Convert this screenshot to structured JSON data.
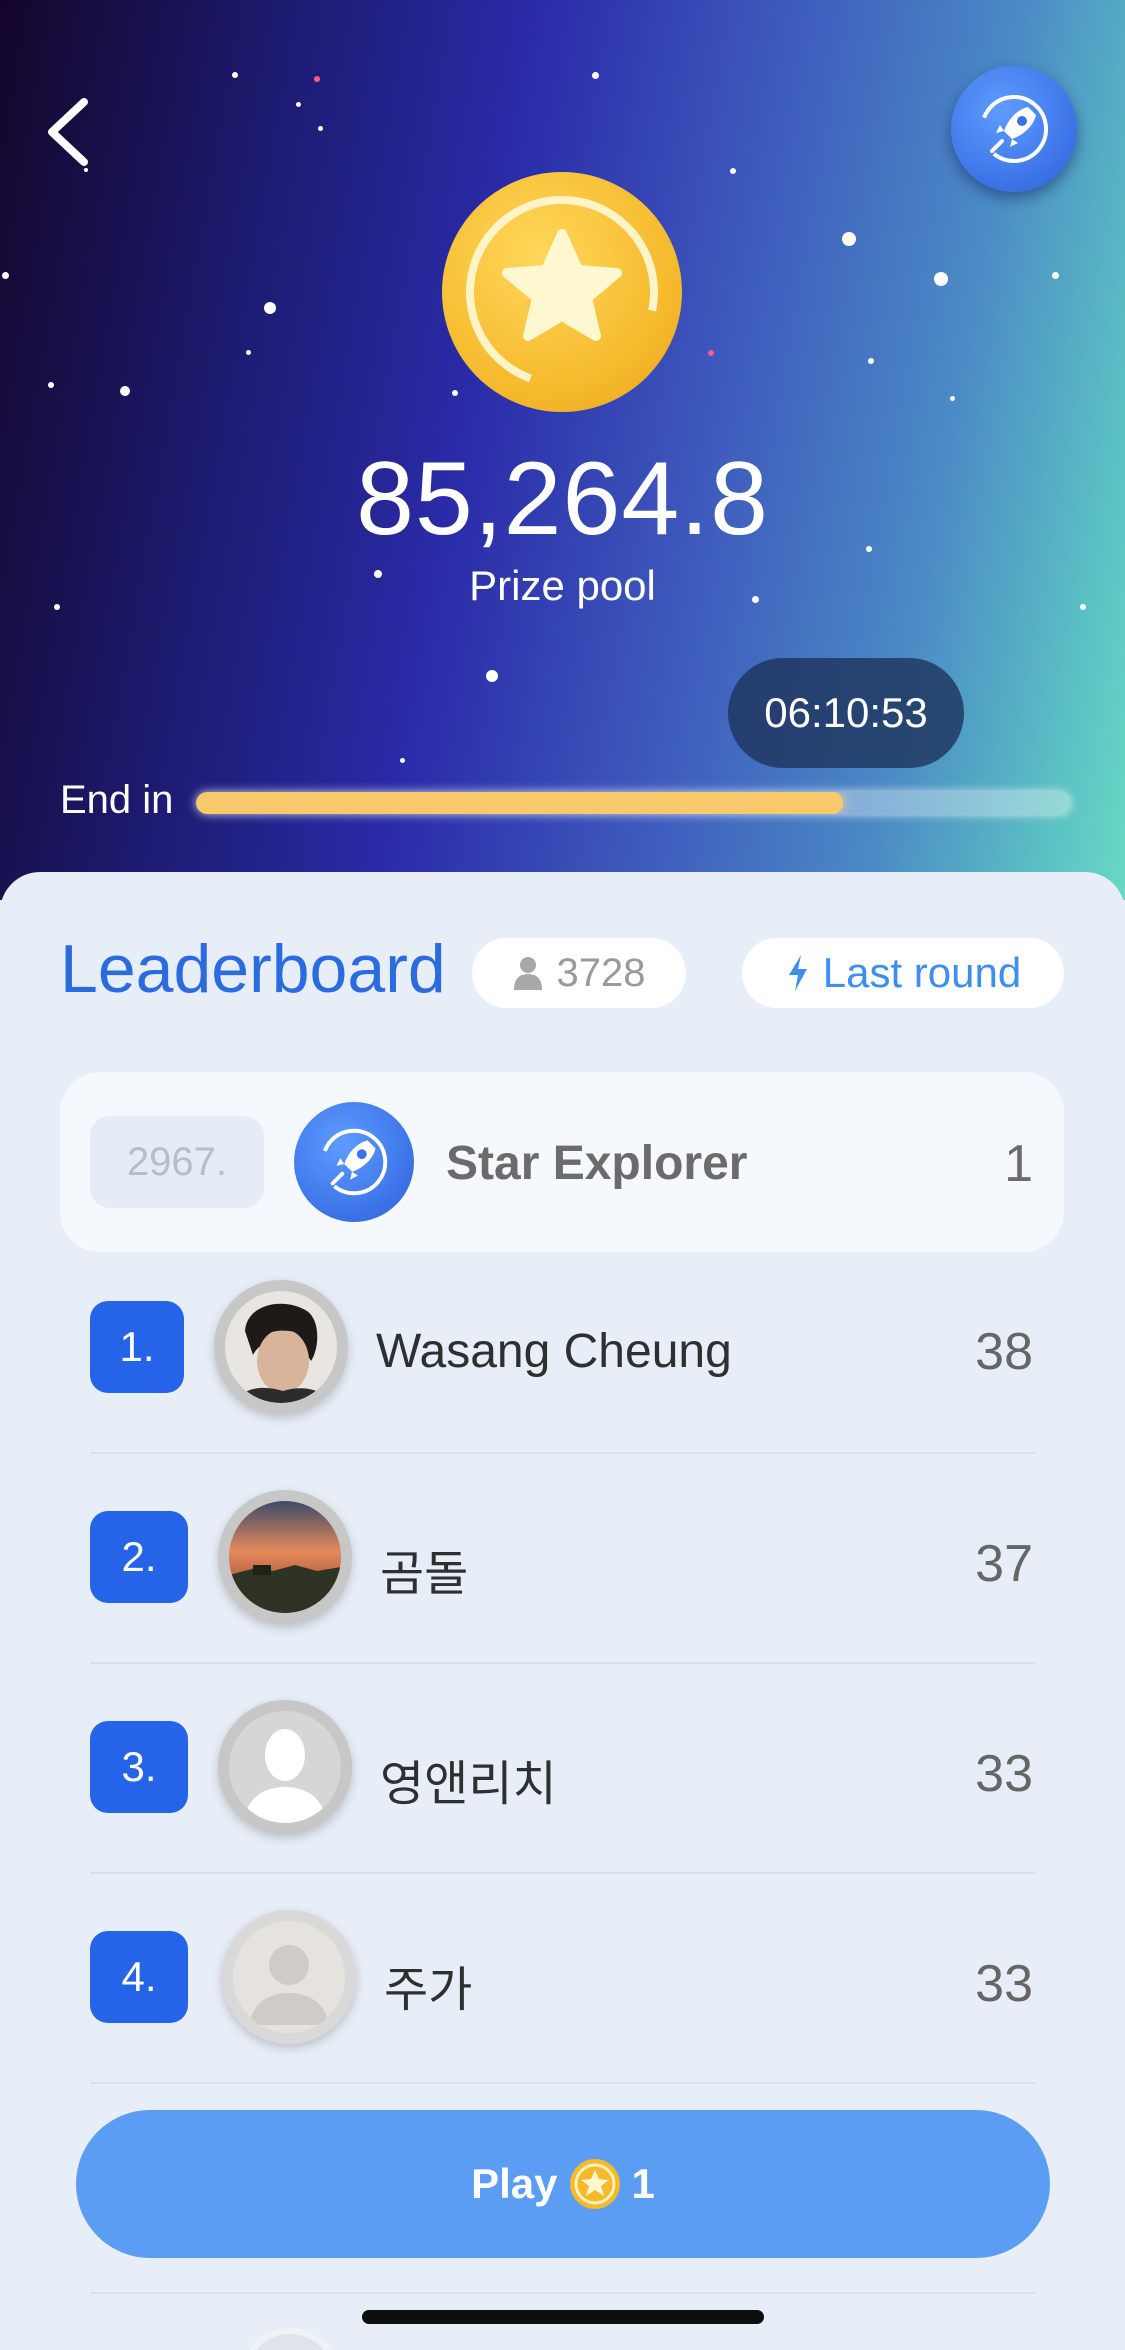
{
  "header": {
    "back_icon": "chevron-left-icon",
    "rocket_icon": "rocket-icon",
    "coin_icon": "star-coin-icon"
  },
  "prize": {
    "amount": "85,264.8",
    "label": "Prize pool"
  },
  "timer": {
    "remaining": "06:10:53",
    "end_label": "End in",
    "progress_fraction": 0.74
  },
  "leaderboard": {
    "title": "Leaderboard",
    "player_count": "3728",
    "last_round_label": "Last round",
    "me": {
      "rank": "2967.",
      "name": "Star Explorer",
      "score": "1"
    },
    "rows": [
      {
        "rank": "1.",
        "name": "Wasang Cheung",
        "score": "38"
      },
      {
        "rank": "2.",
        "name": "곰돌",
        "score": "37"
      },
      {
        "rank": "3.",
        "name": "영앤리치",
        "score": "33"
      },
      {
        "rank": "4.",
        "name": "주가",
        "score": "33"
      }
    ]
  },
  "play": {
    "label": "Play",
    "cost": "1"
  },
  "colors": {
    "accent": "#2563e8",
    "title_blue": "#2a6be0",
    "play_button": "#5b9df2",
    "progress": "#f7c96a"
  }
}
